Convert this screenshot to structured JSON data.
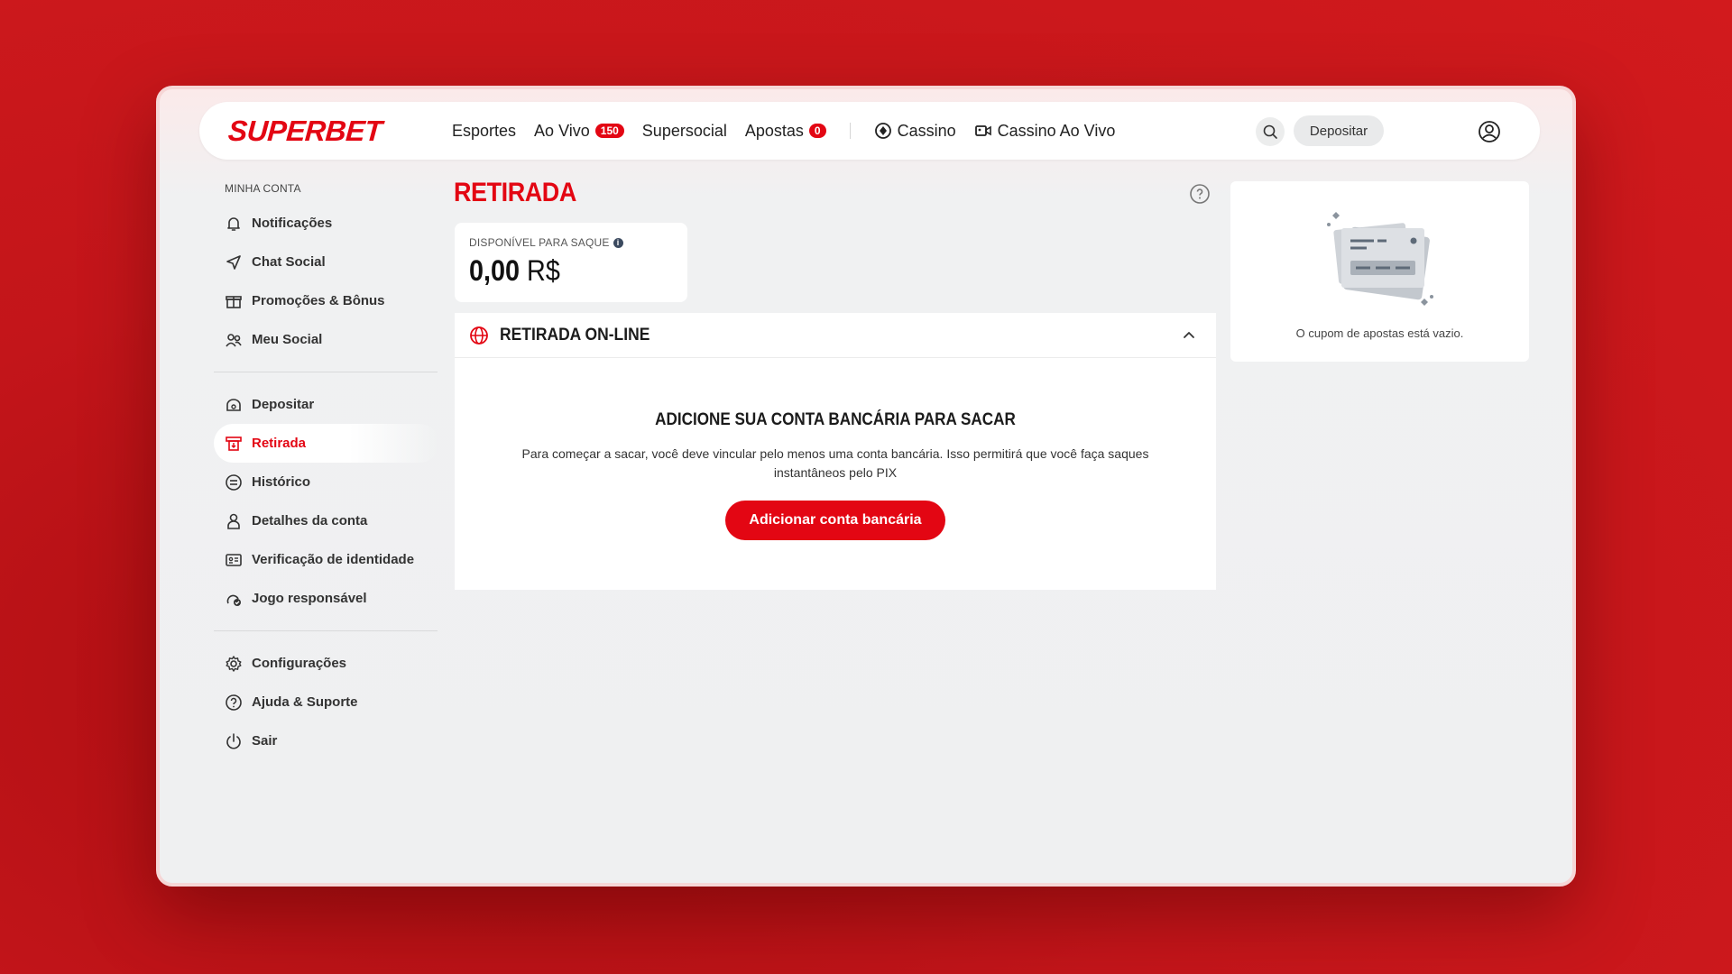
{
  "header": {
    "logo": "SUPERBET",
    "nav": [
      {
        "label": "Esportes"
      },
      {
        "label": "Ao Vivo",
        "badge": "150"
      },
      {
        "label": "Supersocial"
      },
      {
        "label": "Apostas",
        "badge": "0"
      },
      {
        "label": "Cassino",
        "icon": "casino-chip-icon"
      },
      {
        "label": "Cassino Ao Vivo",
        "icon": "live-video-icon"
      }
    ],
    "deposit_label": "Depositar"
  },
  "sidebar": {
    "section_title": "MINHA CONTA",
    "items": [
      {
        "label": "Notificações",
        "icon": "bell-icon"
      },
      {
        "label": "Chat Social",
        "icon": "send-icon"
      },
      {
        "label": "Promoções & Bônus",
        "icon": "gift-icon"
      },
      {
        "label": "Meu Social",
        "icon": "users-icon"
      },
      {
        "label": "Depositar",
        "icon": "cash-icon"
      },
      {
        "label": "Retirada",
        "icon": "withdraw-icon",
        "active": true
      },
      {
        "label": "Histórico",
        "icon": "history-icon"
      },
      {
        "label": "Detalhes da conta",
        "icon": "user-icon"
      },
      {
        "label": "Verificação de identidade",
        "icon": "id-card-icon"
      },
      {
        "label": "Jogo responsável",
        "icon": "responsible-game-icon"
      },
      {
        "label": "Configurações",
        "icon": "gear-icon"
      },
      {
        "label": "Ajuda & Suporte",
        "icon": "help-circle-icon"
      },
      {
        "label": "Sair",
        "icon": "power-icon"
      }
    ]
  },
  "main": {
    "title": "RETIRADA",
    "balance": {
      "label": "DISPONÍVEL PARA SAQUE",
      "amount": "0,00",
      "currency": "R$"
    },
    "online": {
      "title": "RETIRADA ON-LINE",
      "heading": "ADICIONE SUA CONTA BANCÁRIA PARA SACAR",
      "text": "Para começar a sacar, você deve vincular pelo menos uma conta bancária. Isso permitirá que você faça saques instantâneos pelo PIX",
      "button": "Adicionar conta bancária"
    }
  },
  "coupon": {
    "empty_text": "O cupom de apostas está vazio."
  },
  "colors": {
    "brand_red": "#e30613",
    "background": "#eff0f1"
  }
}
